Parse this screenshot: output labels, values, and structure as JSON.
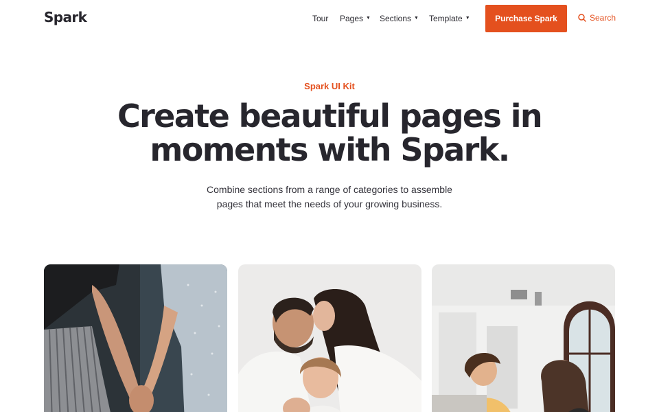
{
  "header": {
    "logo": "Spark",
    "nav": [
      {
        "label": "Tour",
        "has_caret": false
      },
      {
        "label": "Pages",
        "has_caret": true
      },
      {
        "label": "Sections",
        "has_caret": true
      },
      {
        "label": "Template",
        "has_caret": true
      }
    ],
    "cta_label": "Purchase Spark",
    "search_label": "Search"
  },
  "hero": {
    "eyebrow": "Spark UI Kit",
    "headline_line1": "Create beautiful pages in",
    "headline_line2": "moments with Spark.",
    "subtitle_line1": "Combine sections from a range of categories to assemble",
    "subtitle_line2": "pages that meet the needs of your growing business."
  },
  "colors": {
    "accent": "#e4501e",
    "text": "#27262d",
    "background": "#ffffff"
  },
  "icons": {
    "search": "search-icon",
    "caret": "caret-down-icon"
  },
  "gallery": [
    {
      "alt": "holding-hands-photo"
    },
    {
      "alt": "family-photo"
    },
    {
      "alt": "office-photo"
    }
  ]
}
